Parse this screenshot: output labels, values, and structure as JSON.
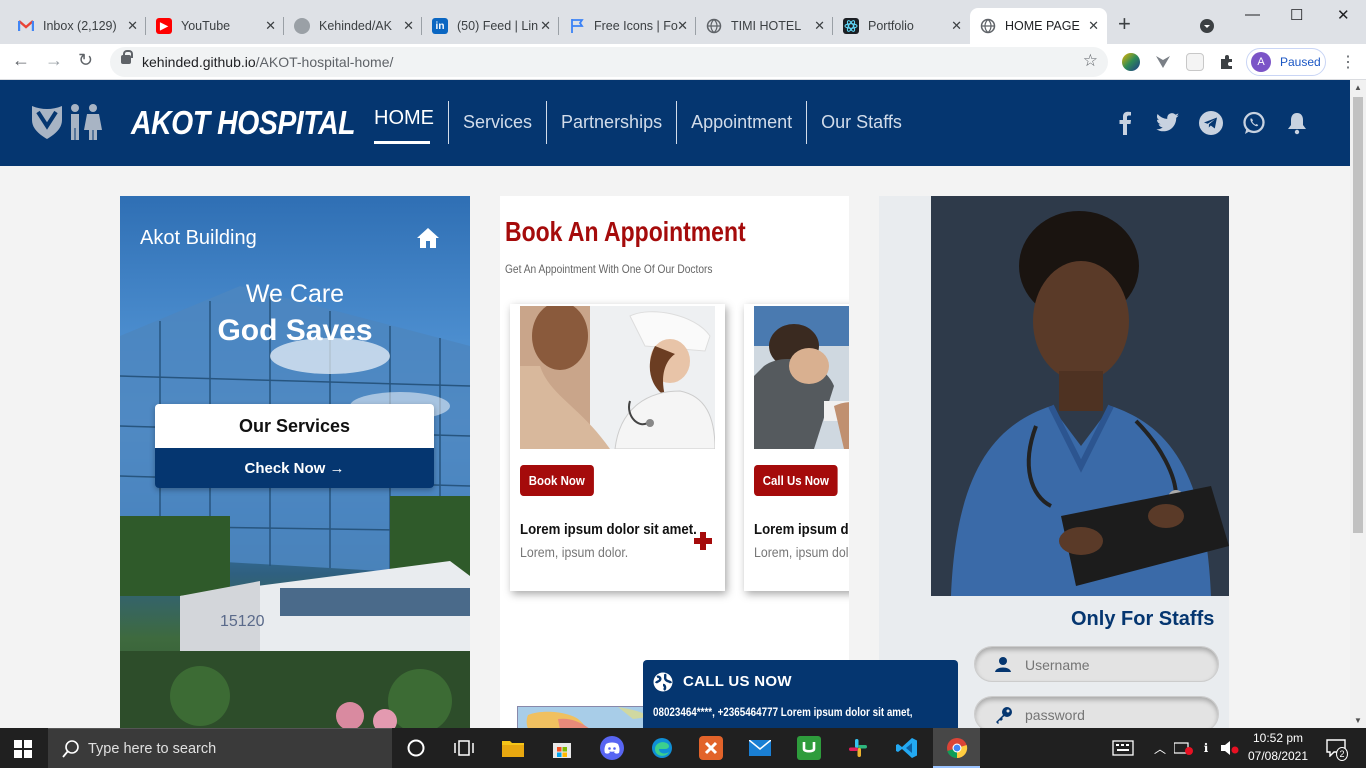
{
  "browser": {
    "tabs": [
      {
        "title": "Inbox (2,129)",
        "icon": "gmail-icon",
        "color": "#ea4335"
      },
      {
        "title": "YouTube",
        "icon": "youtube-icon",
        "color": "#ff0000"
      },
      {
        "title": "Kehinded/AK",
        "icon": "github-icon",
        "color": "#5f6368"
      },
      {
        "title": "(50) Feed | Lin",
        "icon": "linkedin-icon",
        "color": "#0a66c2"
      },
      {
        "title": "Free Icons | Fo",
        "icon": "flag-icon",
        "color": "#3b82f6"
      },
      {
        "title": "TIMI HOTEL",
        "icon": "globe-icon",
        "color": "#5f6368"
      },
      {
        "title": "Portfolio",
        "icon": "react-icon",
        "color": "#61dafb"
      },
      {
        "title": "HOME PAGE",
        "icon": "globe-icon",
        "color": "#5f6368"
      }
    ],
    "url_host": "kehinded.github.io",
    "url_path": "/AKOT-hospital-home/",
    "profile_initial": "A",
    "profile_status": "Paused"
  },
  "site": {
    "brand": "AKOT HOSPITAL",
    "nav": [
      "HOME",
      "Services",
      "Partnerships",
      "Appointment",
      "Our Staffs"
    ],
    "social": [
      "facebook-icon",
      "twitter-icon",
      "telegram-icon",
      "whatsapp-icon",
      "bell-icon"
    ]
  },
  "left_card": {
    "location": "Akot Building",
    "tagline1": "We Care",
    "tagline2": "God Saves",
    "services_label": "Our Services",
    "check_label": "Check Now →"
  },
  "appointment": {
    "title": "Book An Appointment",
    "subtitle": "Get An Appointment With One Of Our Doctors",
    "cards": [
      {
        "button": "Book Now",
        "heading": "Lorem ipsum dolor sit amet.",
        "text": "Lorem, ipsum dolor."
      },
      {
        "button": "Call Us Now",
        "heading": "Lorem ipsum dolor sit amet.",
        "text": "Lorem, ipsum dolor."
      }
    ]
  },
  "call_now": {
    "title": "CALL US NOW",
    "phones": "08023464****, +2365464777 Lorem ipsum dolor sit amet,"
  },
  "staff_login": {
    "title": "Only For Staffs",
    "username_placeholder": "Username",
    "password_placeholder": "password"
  },
  "taskbar": {
    "search_placeholder": "Type here to search",
    "time": "10:52 pm",
    "date": "07/08/2021",
    "notifications": "2"
  },
  "colors": {
    "brand_navy": "#053670",
    "accent_red": "#a50b0b"
  }
}
